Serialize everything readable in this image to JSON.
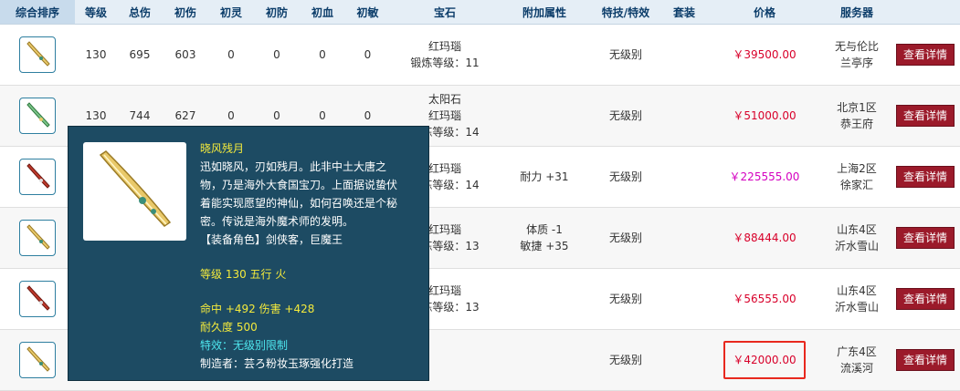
{
  "headers": [
    "综合排序",
    "等级",
    "总伤",
    "初伤",
    "初灵",
    "初防",
    "初血",
    "初敏",
    "宝石",
    "附加属性",
    "特技/特效",
    "套装",
    "价格",
    "服务器",
    ""
  ],
  "rows": [
    {
      "weapon": "golden",
      "level": "130",
      "total": "695",
      "init_dmg": "603",
      "init_ling": "0",
      "init_def": "0",
      "init_hp": "0",
      "init_agi": "0",
      "gem": [
        "红玛瑙",
        "锻炼等级：11"
      ],
      "attr": [],
      "effect": "无级别",
      "suit": "",
      "price": "￥39500.00",
      "price_style": "red",
      "server": [
        "无与伦比",
        "兰亭序"
      ],
      "button": "查看详情"
    },
    {
      "weapon": "green",
      "level": "130",
      "total": "744",
      "init_dmg": "627",
      "init_ling": "0",
      "init_def": "0",
      "init_hp": "0",
      "init_agi": "0",
      "gem": [
        "太阳石",
        "红玛瑙",
        "锻炼等级：14"
      ],
      "attr": [],
      "effect": "无级别",
      "suit": "",
      "price": "￥51000.00",
      "price_style": "red",
      "server": [
        "北京1区",
        "恭王府"
      ],
      "button": "查看详情"
    },
    {
      "weapon": "red",
      "level": "",
      "total": "",
      "init_dmg": "",
      "init_ling": "",
      "init_def": "",
      "init_hp": "",
      "init_agi": "",
      "gem": [
        "红玛瑙",
        "锻炼等级：14"
      ],
      "attr": [
        "耐力 +31"
      ],
      "effect": "无级别",
      "suit": "",
      "price": "￥225555.00",
      "price_style": "pink",
      "server": [
        "上海2区",
        "徐家汇"
      ],
      "button": "查看详情"
    },
    {
      "weapon": "golden",
      "level": "",
      "total": "",
      "init_dmg": "",
      "init_ling": "",
      "init_def": "",
      "init_hp": "",
      "init_agi": "",
      "gem": [
        "红玛瑙",
        "锻炼等级：13"
      ],
      "attr": [
        "体质 -1",
        "敏捷 +35"
      ],
      "effect": "无级别",
      "suit": "",
      "price": "￥88444.00",
      "price_style": "red",
      "server": [
        "山东4区",
        "沂水雪山"
      ],
      "button": "查看详情"
    },
    {
      "weapon": "red",
      "level": "",
      "total": "",
      "init_dmg": "",
      "init_ling": "",
      "init_def": "",
      "init_hp": "",
      "init_agi": "",
      "gem": [
        "红玛瑙",
        "锻炼等级：13"
      ],
      "attr": [],
      "effect": "无级别",
      "suit": "",
      "price": "￥56555.00",
      "price_style": "red",
      "server": [
        "山东4区",
        "沂水雪山"
      ],
      "button": "查看详情"
    },
    {
      "weapon": "golden",
      "level": "",
      "total": "",
      "init_dmg": "",
      "init_ling": "",
      "init_def": "",
      "init_hp": "",
      "init_agi": "",
      "gem": [],
      "attr": [],
      "effect": "无级别",
      "suit": "",
      "price": "￥42000.00",
      "price_style": "highlight",
      "server": [
        "广东4区",
        "流溪河"
      ],
      "button": "查看详情"
    }
  ],
  "tooltip": {
    "name": "晓风残月",
    "desc": [
      "迅如晓风，刃如残月。此非中土大唐之",
      "物，乃是海外大食国宝刀。上面据说蛰伏",
      "着能实现愿望的神仙，如何召唤还是个秘",
      "密。传说是海外魔术师的发明。"
    ],
    "roles": "【装备角色】剑侠客，巨魔王",
    "level_line": "等级 130 五行 火",
    "stats_line": "命中 +492 伤害 +428",
    "durability": "耐久度 500",
    "effect_line": "特效：无级别限制",
    "maker": "制造者：芸ろ粉妆玉琢强化打造"
  },
  "colors": {
    "header_bg": "#e5eef6",
    "header_text": "#0c3d6a",
    "price_red": "#d8002a",
    "price_pink": "#d400c0",
    "button_bg": "#9b1a2a",
    "tooltip_bg": "#1d4b63",
    "tooltip_yellow": "#f4ea3c",
    "tooltip_cyan": "#4ee6ee",
    "highlight_border": "#e8281e"
  }
}
